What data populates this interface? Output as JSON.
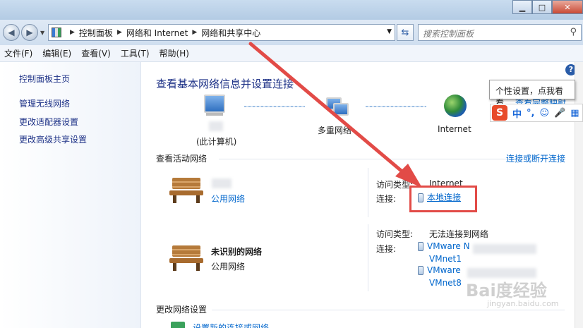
{
  "window": {
    "min_label": "▁",
    "max_label": "□",
    "close_label": "✕"
  },
  "address": {
    "back_icon": "◀",
    "forward_icon": "▶",
    "breadcrumbs": [
      "控制面板",
      "网络和 Internet",
      "网络和共享中心"
    ],
    "search_placeholder": "搜索控制面板"
  },
  "menu": [
    "文件(F)",
    "编辑(E)",
    "查看(V)",
    "工具(T)",
    "帮助(H)"
  ],
  "left_panel": {
    "links": [
      "控制面板主页",
      "管理无线网络",
      "更改适配器设置",
      "更改高级共享设置"
    ]
  },
  "main": {
    "title": "查看基本网络信息并设置连接",
    "help_label": "?",
    "map": {
      "computer_label": "(此计算机)",
      "middle_label": "多重网络",
      "internet_label": "Internet",
      "view_full_map": "查看完整映射"
    },
    "active_header": "查看活动网络",
    "connect_link": "连接或断开连接",
    "networks": [
      {
        "name": "",
        "type": "公用网络",
        "access_label": "访问类型:",
        "access_value": "Internet",
        "conn_label": "连接:",
        "connections": [
          "本地连接"
        ]
      },
      {
        "name": "未识别的网络",
        "type": "公用网络",
        "access_label": "访问类型:",
        "access_value": "无法连接到网络",
        "conn_label": "连接:",
        "connections": [
          "VMware N",
          "VMnet1",
          "VMware",
          "VMnet8"
        ]
      }
    ],
    "change_header": "更改网络设置",
    "setup_link": "设置新的连接或网络"
  },
  "tooltip": "个性设置，点我看看",
  "ime": {
    "logo": "S",
    "items": [
      "中",
      "°,",
      "☺",
      "🎤",
      "▦"
    ]
  },
  "watermark": {
    "main": "Bai度经验",
    "sub": "jingyan.baidu.com"
  },
  "colors": {
    "link": "#0066cc",
    "title": "#1e3287",
    "highlight_box": "#e24b47",
    "arrow": "#e24b47"
  }
}
